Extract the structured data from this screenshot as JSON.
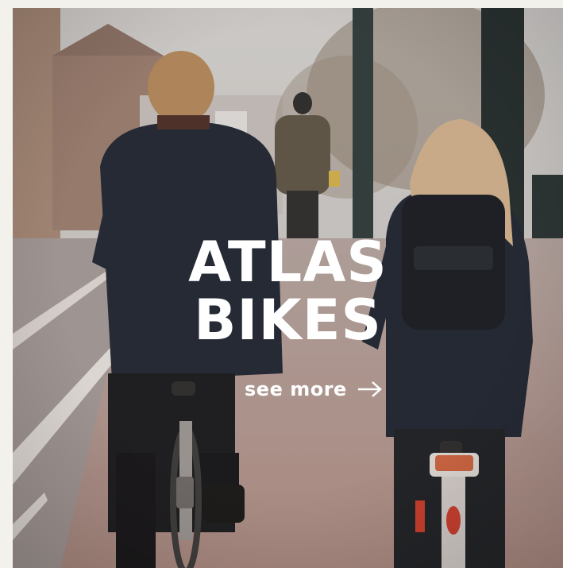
{
  "brand": {
    "line1": "ATLAS",
    "line2": "BIKES"
  },
  "cta": {
    "label": "see more",
    "arrow_icon": "arrow-right-icon"
  },
  "photo": {
    "subject": "two-cyclists-on-bike-lane",
    "colors": {
      "background": "#f3f1ec",
      "text": "#ffffff",
      "bike_lane": "#b49a92",
      "jacket": "#1b2330",
      "hair_blonde": "#d6b690"
    }
  }
}
